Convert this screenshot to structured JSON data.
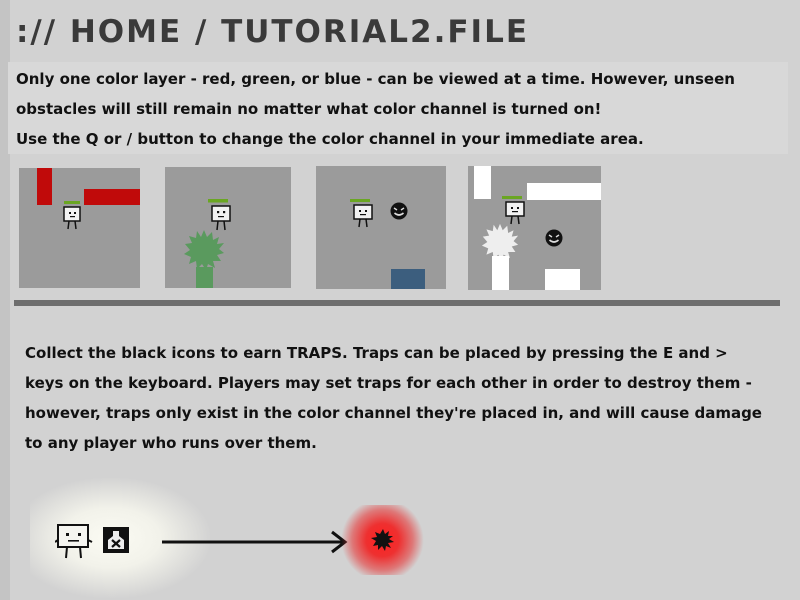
{
  "header": {
    "title": ":// HOME / TUTORIAL2.FILE"
  },
  "intro": {
    "line1": "Only one color layer - red, green, or blue - can be viewed at a time. However, unseen",
    "line2": "obstacles will still remain no matter what color channel is turned on!",
    "line3": "Use the Q or / button to change the color channel in your immediate area."
  },
  "panels": [
    {
      "name": "red-channel-example",
      "accent": "#c00a0a"
    },
    {
      "name": "green-channel-example",
      "accent": "#5a9a5e"
    },
    {
      "name": "blue-channel-example",
      "accent": "#3c5e7e"
    },
    {
      "name": "all-obstacles-example",
      "accent": "#ffffff"
    }
  ],
  "traps": {
    "line1": "Collect the black icons to earn TRAPS. Traps can be placed by pressing the E and >",
    "line2": "keys on the keyboard. Players may set traps for each other in order to destroy them -",
    "line3": "however, traps only exist in the color channel they're placed in, and will cause damage",
    "line4": "to any player who runs over them."
  },
  "colors": {
    "background": "#d2d2d2",
    "panel": "#9b9b9b",
    "health_bar": "#6aa622",
    "divider": "#6e6e6e",
    "trap_glow": "#ff2020"
  },
  "icons": [
    "robot-player-icon",
    "enemy-smiley-icon",
    "saw-blade-icon",
    "trap-item-icon",
    "arrow-icon",
    "trap-mine-icon"
  ]
}
